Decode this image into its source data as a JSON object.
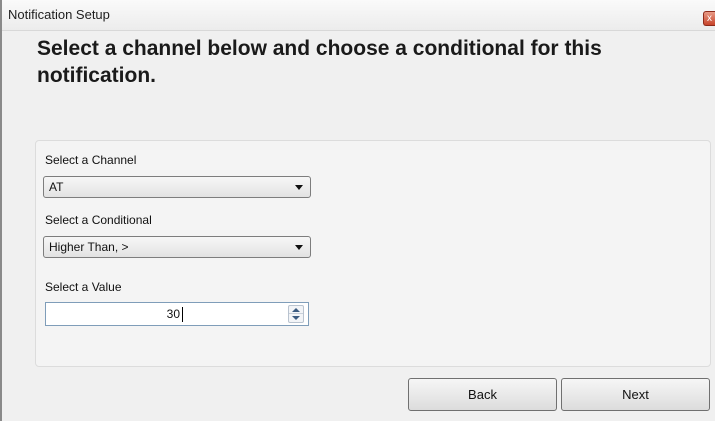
{
  "window": {
    "title": "Notification Setup",
    "close_glyph": "x"
  },
  "heading": "Select a channel below and choose a conditional for this notification.",
  "form": {
    "channel": {
      "label": "Select a Channel",
      "selected": "AT"
    },
    "conditional": {
      "label": "Select a Conditional",
      "selected": "Higher Than, >"
    },
    "value": {
      "label": "Select a Value",
      "value": "30"
    }
  },
  "buttons": {
    "back_label": "Back",
    "next_label": "Next"
  },
  "icons": {
    "close": "close-icon",
    "dropdown": "chevron-down-icon",
    "spin_up": "arrow-up-icon",
    "spin_down": "arrow-down-icon"
  },
  "colors": {
    "window_bg": "#f0f0f0",
    "close_button": "#c7442a",
    "spinner_border": "#7f9db9"
  }
}
